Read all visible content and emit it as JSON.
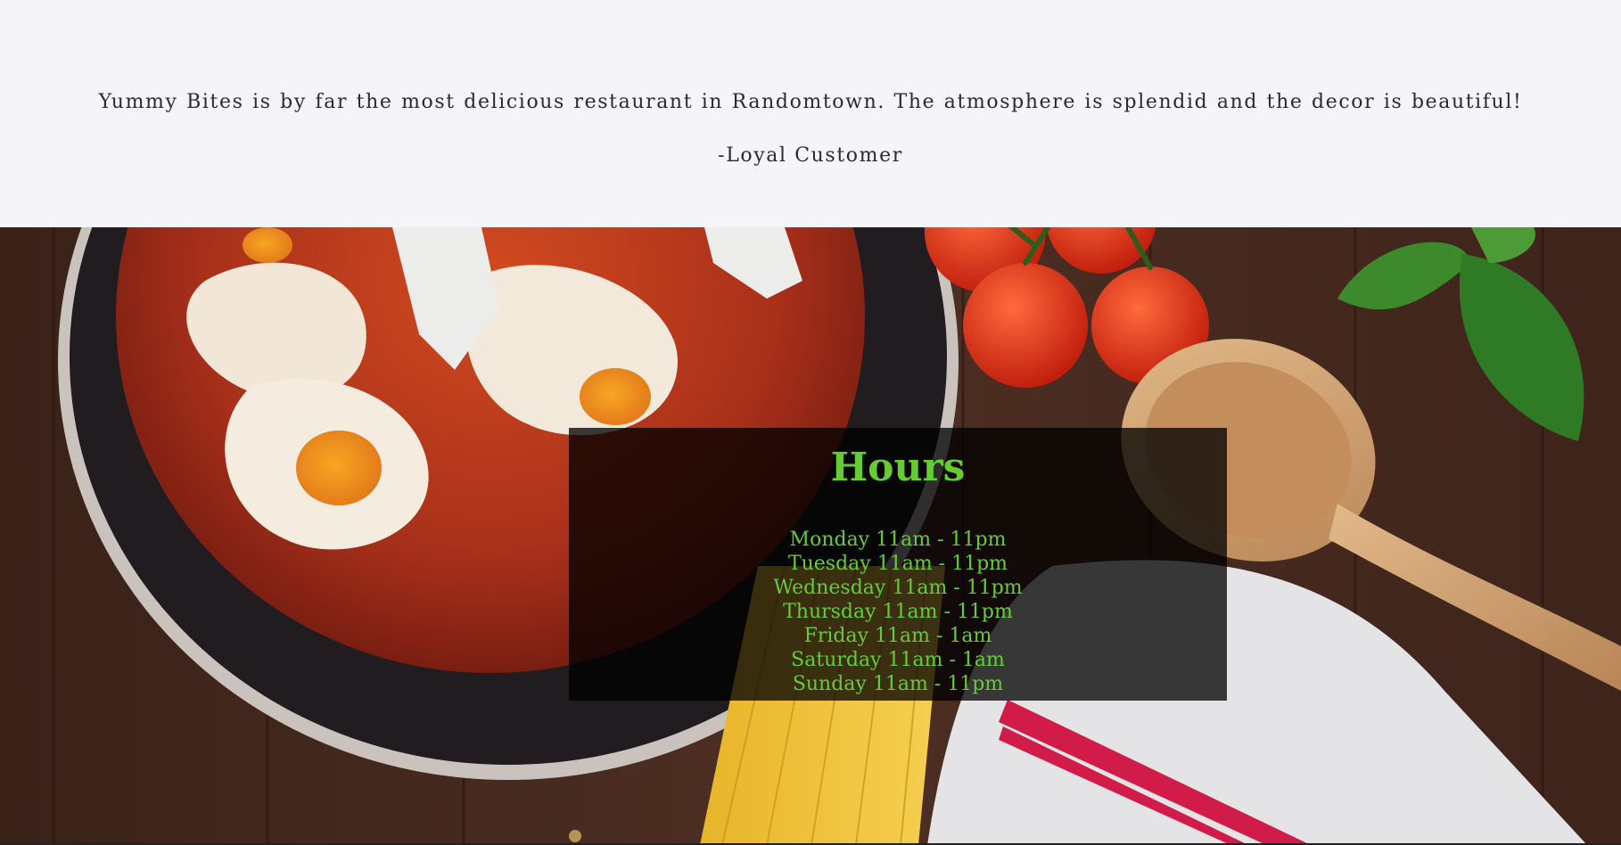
{
  "testimonial": {
    "quote": "Yummy Bites is by far the most delicious restaurant in Randomtown. The atmosphere is splendid and the decor is beautiful!",
    "author": "-Loyal Customer"
  },
  "hours": {
    "title": "Hours",
    "items": [
      {
        "text": "Monday 11am - 11pm"
      },
      {
        "text": "Tuesday 11am - 11pm"
      },
      {
        "text": "Wednesday 11am - 11pm"
      },
      {
        "text": "Thursday 11am - 11pm"
      },
      {
        "text": "Friday 11am - 1am"
      },
      {
        "text": "Saturday 11am - 1am"
      },
      {
        "text": "Sunday 11am - 11pm"
      }
    ]
  },
  "colors": {
    "hours_text": "#66cc33",
    "page_background": "#f5f4f8",
    "overlay": "rgba(0,0,0,0.76)"
  }
}
